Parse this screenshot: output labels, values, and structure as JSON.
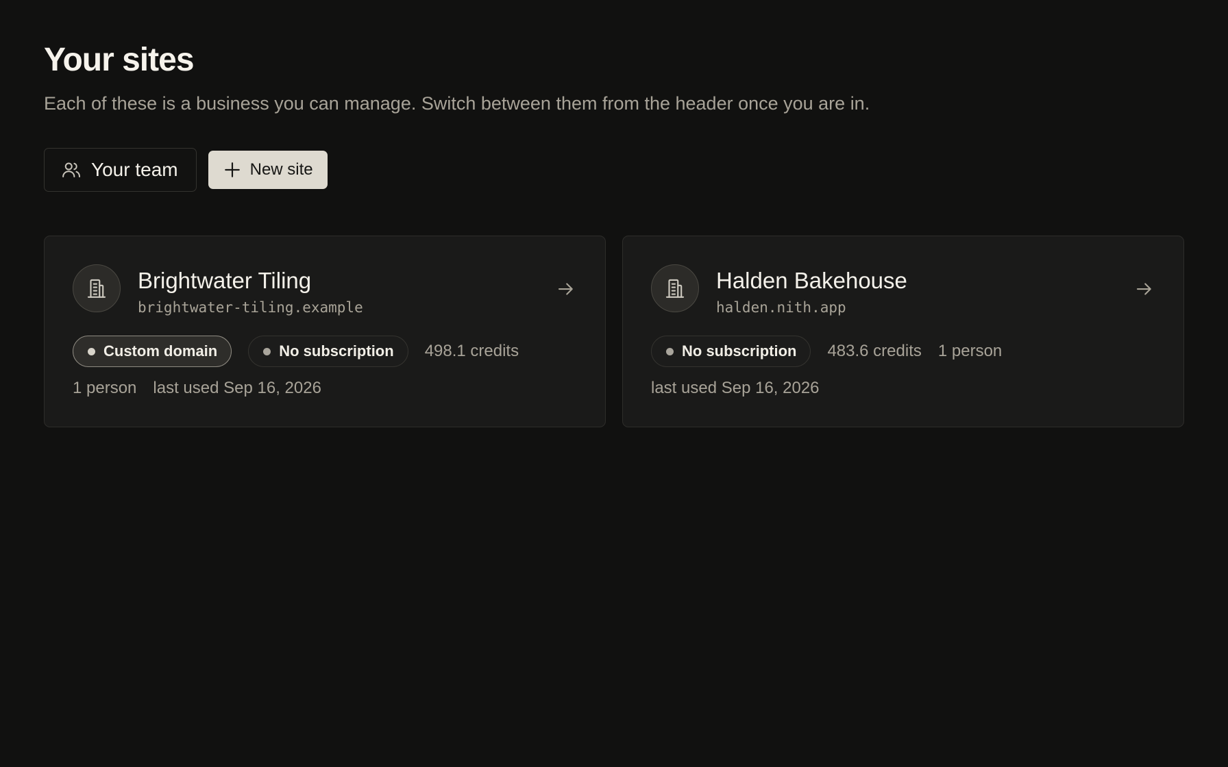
{
  "header": {
    "title": "Your sites",
    "subtitle": "Each of these is a business you can manage. Switch between them from the header once you are in."
  },
  "actions": {
    "team_label": "Your team",
    "new_site_label": "New site"
  },
  "sites": [
    {
      "name": "Brightwater Tiling",
      "domain": "brightwater-tiling.example",
      "badges": [
        "Custom domain",
        "No subscription"
      ],
      "credits": "498.1 credits",
      "people": "1 person",
      "last_used": "last used Sep 16, 2026"
    },
    {
      "name": "Halden Bakehouse",
      "domain": "halden.nith.app",
      "badges": [
        "No subscription"
      ],
      "credits": "483.6 credits",
      "people": "1 person",
      "last_used": "last used Sep 16, 2026"
    }
  ],
  "icons": {
    "team": "users-icon",
    "new_site": "plus-icon",
    "site": "building-icon",
    "open": "arrow-right-icon",
    "badge": "dot-icon"
  },
  "colors": {
    "background": "#111110",
    "card": "#1a1a19",
    "primary_button": "#dedad0",
    "muted_text": "#a8a398"
  }
}
